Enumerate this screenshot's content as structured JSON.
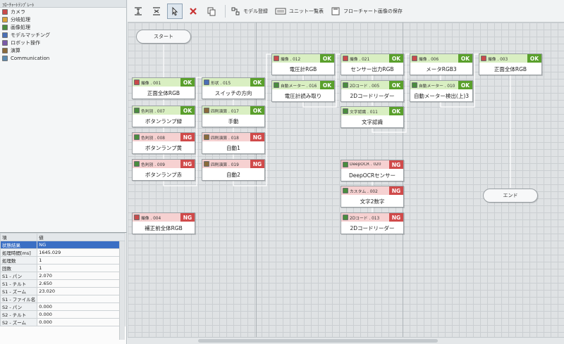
{
  "template_panel": {
    "title": "ﾌﾛｰﾁｬｰﾄﾃﾝﾌﾟﾚｰﾄ",
    "items": [
      {
        "label": "カメラ",
        "icon": "camera-icon",
        "color": "#c94a4a"
      },
      {
        "label": "分岐処理",
        "icon": "branch-icon",
        "color": "#d9a43a"
      },
      {
        "label": "画像処理",
        "icon": "image-process-icon",
        "color": "#4a8d3e"
      },
      {
        "label": "モデルマッチング",
        "icon": "model-matching-icon",
        "color": "#4a6fb5"
      },
      {
        "label": "ロボット操作",
        "icon": "robot-icon",
        "color": "#7a5aa8"
      },
      {
        "label": "演算",
        "icon": "calc-icon",
        "color": "#8a6a3a"
      },
      {
        "label": "Communication",
        "icon": "communication-icon",
        "color": "#5a8ab0"
      }
    ]
  },
  "properties": {
    "header": [
      "項",
      "値"
    ],
    "rows": [
      {
        "key": "状態結果",
        "value": "NG",
        "selected": true
      },
      {
        "key": "処理時間[ms]",
        "value": "1645.029"
      },
      {
        "key": "処理数",
        "value": "1"
      },
      {
        "key": "回数",
        "value": "1"
      },
      {
        "key": "S1 - パン",
        "value": "2.070"
      },
      {
        "key": "S1 - チルト",
        "value": "2.650"
      },
      {
        "key": "S1 - ズーム",
        "value": "23.020"
      },
      {
        "key": "S1 - ファイル名",
        "value": ""
      },
      {
        "key": "S2 - パン",
        "value": "0.000"
      },
      {
        "key": "S2 - チルト",
        "value": "0.000"
      },
      {
        "key": "S2 - ズーム",
        "value": "0.000"
      }
    ]
  },
  "toolbar": {
    "model_register": "モデル登録",
    "unit_list": "ユニット一覧表",
    "save_flowchart": "フローチャート画像の保存"
  },
  "flow": {
    "start": "スタート",
    "end": "エンド",
    "nodes": [
      {
        "id": "n001",
        "head": "撮像 . 001",
        "status": "OK",
        "label": "正面全体RGB",
        "icon_color": "#c94a4a"
      },
      {
        "id": "n007",
        "head": "色判別 . 007",
        "status": "OK",
        "label": "ボタンランプ緑",
        "icon_color": "#4a8d3e"
      },
      {
        "id": "n008",
        "head": "色判別 . 008",
        "status": "NG",
        "label": "ボタンランプ黄",
        "icon_color": "#4a8d3e"
      },
      {
        "id": "n009",
        "head": "色判別 . 009",
        "status": "NG",
        "label": "ボタンランプ赤",
        "icon_color": "#4a8d3e"
      },
      {
        "id": "n004",
        "head": "撮像 . 004",
        "status": "NG",
        "label": "補正前全体RGB",
        "icon_color": "#c94a4a"
      },
      {
        "id": "n015",
        "head": "形状 . 015",
        "status": "OK",
        "label": "スイッチの方向",
        "icon_color": "#4a6fb5"
      },
      {
        "id": "n017",
        "head": "四則演算 . 017",
        "status": "OK",
        "label": "手動",
        "icon_color": "#8a6a3a"
      },
      {
        "id": "n018",
        "head": "四則演算 . 018",
        "status": "NG",
        "label": "自動1",
        "icon_color": "#8a6a3a"
      },
      {
        "id": "n019",
        "head": "四則演算 . 019",
        "status": "NG",
        "label": "自動2",
        "icon_color": "#8a6a3a"
      },
      {
        "id": "n012",
        "head": "撮像 . 012",
        "status": "OK",
        "label": "電圧計RGB",
        "icon_color": "#c94a4a"
      },
      {
        "id": "n016",
        "head": "自動メーター . 016",
        "status": "OK",
        "label": "電圧計読み取り",
        "icon_color": "#4a8d3e"
      },
      {
        "id": "n021",
        "head": "撮像 . 021",
        "status": "OK",
        "label": "センサー出力RGB",
        "icon_color": "#c94a4a"
      },
      {
        "id": "n005",
        "head": "2Dコード . 005",
        "status": "OK",
        "label": "2Dコードリーダー",
        "icon_color": "#4a8d3e"
      },
      {
        "id": "n011",
        "head": "文字認識 . 011",
        "status": "OK",
        "label": "文字認識",
        "icon_color": "#4a8d3e"
      },
      {
        "id": "n020",
        "head": "DeepOCR . 020",
        "status": "NG",
        "label": "DeepOCRセンサー",
        "icon_color": "#4a8d3e"
      },
      {
        "id": "n002",
        "head": "カスタム . 002",
        "status": "NG",
        "label": "文字2数字",
        "icon_color": "#4a8d3e"
      },
      {
        "id": "n013",
        "head": "2Dコード . 013",
        "status": "NG",
        "label": "2Dコードリーダー",
        "icon_color": "#4a8d3e"
      },
      {
        "id": "n006",
        "head": "撮像 . 006",
        "status": "OK",
        "label": "メータRGB3",
        "icon_color": "#c94a4a"
      },
      {
        "id": "n010",
        "head": "自動メーター . 010",
        "status": "OK",
        "label": "自動メーター検出(上)3",
        "icon_color": "#4a8d3e"
      },
      {
        "id": "n003",
        "head": "撮像 . 003",
        "status": "OK",
        "label": "正面全体RGB",
        "icon_color": "#c94a4a"
      }
    ]
  }
}
